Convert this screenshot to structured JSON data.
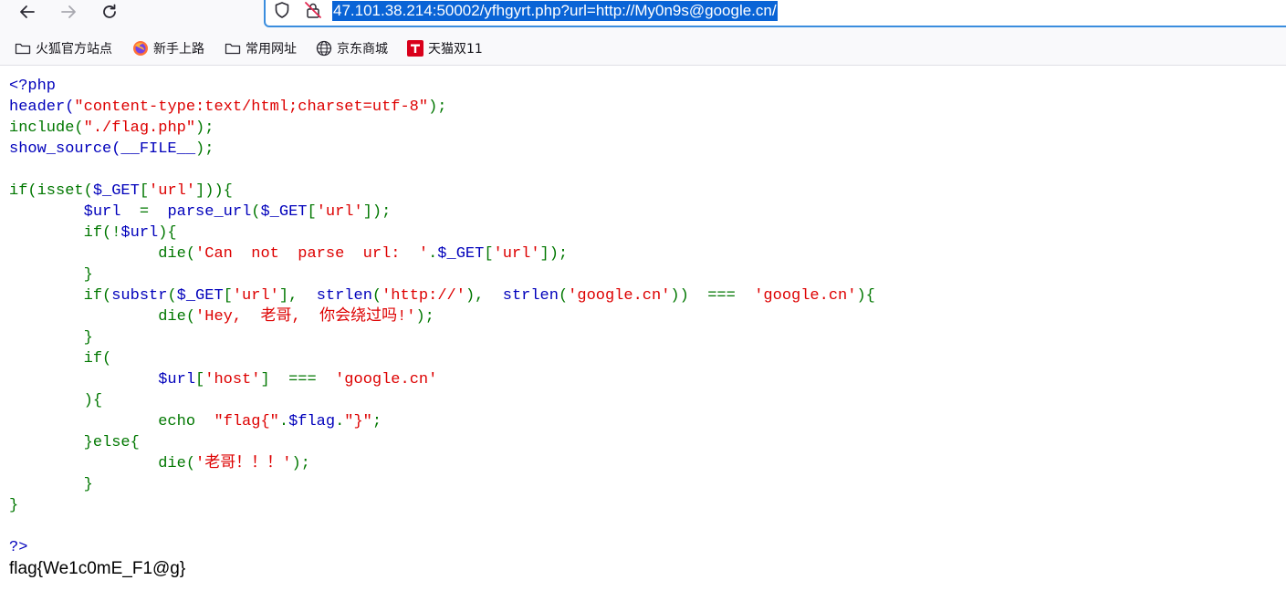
{
  "browser": {
    "url": "47.101.38.214:50002/yfhgyrt.php?url=http://My0n9s@google.cn/",
    "icons": [
      "back-arrow-icon",
      "forward-arrow-icon",
      "reload-icon",
      "shield-icon",
      "insecure-lock-icon"
    ]
  },
  "bookmarks": [
    {
      "label": "火狐官方站点",
      "icon": "folder-icon"
    },
    {
      "label": "新手上路",
      "icon": "firefox-icon"
    },
    {
      "label": "常用网址",
      "icon": "folder-icon"
    },
    {
      "label": "京东商城",
      "icon": "globe-icon"
    },
    {
      "label": "天猫双11",
      "icon": "tmall-icon"
    }
  ],
  "code": {
    "l1": [
      "<?php"
    ],
    "l2": [
      "header(",
      "\"content-type:text/html;charset=utf-8\"",
      ");"
    ],
    "l3": [
      "include(",
      "\"./flag.php\"",
      ");"
    ],
    "l4": [
      "show_source(",
      "__FILE__",
      ");"
    ],
    "l5": [
      "if(isset(",
      "$_GET",
      "[",
      "'url'",
      "])){"
    ],
    "l6": [
      "        ",
      "$url",
      "  =  ",
      "parse_url",
      "(",
      "$_GET",
      "[",
      "'url'",
      "]);"
    ],
    "l7": [
      "        if(!",
      "$url",
      "){"
    ],
    "l8": [
      "                die(",
      "'Can  not  parse  url:  '",
      ".",
      "$_GET",
      "[",
      "'url'",
      "]);"
    ],
    "l9": [
      "        }"
    ],
    "l10": [
      "        if(",
      "substr",
      "(",
      "$_GET",
      "[",
      "'url'",
      "],  ",
      "strlen",
      "(",
      "'http://'",
      "),  ",
      "strlen",
      "(",
      "'google.cn'",
      "))  ===  ",
      "'google.cn'",
      "){"
    ],
    "l11": [
      "                die(",
      "'Hey,  老哥,  你会绕过吗!'",
      ");"
    ],
    "l12": [
      "        }"
    ],
    "l13": [
      "        if("
    ],
    "l14": [
      "                ",
      "$url",
      "[",
      "'host'",
      "]  ===  ",
      "'google.cn'"
    ],
    "l15": [
      "        ){"
    ],
    "l16": [
      "                echo  ",
      "\"flag{\"",
      ".",
      "$flag",
      ".",
      "\"}\"",
      ";"
    ],
    "l17": [
      "        }else{"
    ],
    "l18": [
      "                die(",
      "'老哥！！！'",
      ");"
    ],
    "l19": [
      "        }"
    ],
    "l20": [
      "}"
    ],
    "l22": [
      "?>"
    ]
  },
  "output": {
    "flag": "flag{We1c0mE_F1@g}"
  },
  "colors": {
    "keyword": "#007700",
    "default": "#0000bb",
    "string": "#dd0000",
    "url_highlight": "#0a64d6"
  }
}
